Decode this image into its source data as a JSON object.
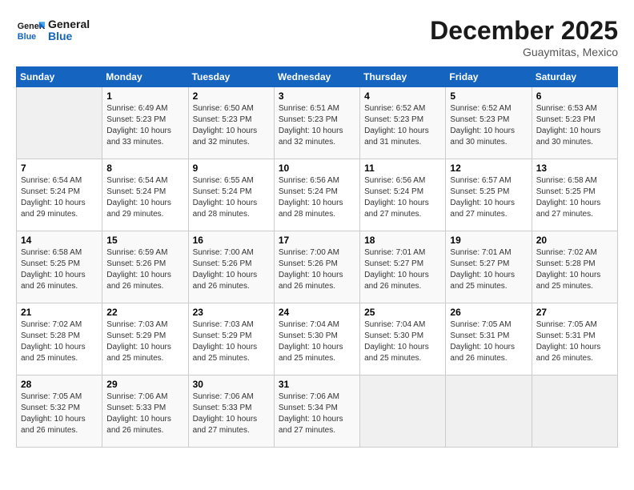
{
  "header": {
    "logo": {
      "line1": "General",
      "line2": "Blue"
    },
    "title": "December 2025",
    "location": "Guaymitas, Mexico"
  },
  "days_of_week": [
    "Sunday",
    "Monday",
    "Tuesday",
    "Wednesday",
    "Thursday",
    "Friday",
    "Saturday"
  ],
  "weeks": [
    [
      {
        "num": "",
        "empty": true
      },
      {
        "num": "1",
        "sunrise": "Sunrise: 6:49 AM",
        "sunset": "Sunset: 5:23 PM",
        "daylight": "Daylight: 10 hours and 33 minutes."
      },
      {
        "num": "2",
        "sunrise": "Sunrise: 6:50 AM",
        "sunset": "Sunset: 5:23 PM",
        "daylight": "Daylight: 10 hours and 32 minutes."
      },
      {
        "num": "3",
        "sunrise": "Sunrise: 6:51 AM",
        "sunset": "Sunset: 5:23 PM",
        "daylight": "Daylight: 10 hours and 32 minutes."
      },
      {
        "num": "4",
        "sunrise": "Sunrise: 6:52 AM",
        "sunset": "Sunset: 5:23 PM",
        "daylight": "Daylight: 10 hours and 31 minutes."
      },
      {
        "num": "5",
        "sunrise": "Sunrise: 6:52 AM",
        "sunset": "Sunset: 5:23 PM",
        "daylight": "Daylight: 10 hours and 30 minutes."
      },
      {
        "num": "6",
        "sunrise": "Sunrise: 6:53 AM",
        "sunset": "Sunset: 5:23 PM",
        "daylight": "Daylight: 10 hours and 30 minutes."
      }
    ],
    [
      {
        "num": "7",
        "sunrise": "Sunrise: 6:54 AM",
        "sunset": "Sunset: 5:24 PM",
        "daylight": "Daylight: 10 hours and 29 minutes."
      },
      {
        "num": "8",
        "sunrise": "Sunrise: 6:54 AM",
        "sunset": "Sunset: 5:24 PM",
        "daylight": "Daylight: 10 hours and 29 minutes."
      },
      {
        "num": "9",
        "sunrise": "Sunrise: 6:55 AM",
        "sunset": "Sunset: 5:24 PM",
        "daylight": "Daylight: 10 hours and 28 minutes."
      },
      {
        "num": "10",
        "sunrise": "Sunrise: 6:56 AM",
        "sunset": "Sunset: 5:24 PM",
        "daylight": "Daylight: 10 hours and 28 minutes."
      },
      {
        "num": "11",
        "sunrise": "Sunrise: 6:56 AM",
        "sunset": "Sunset: 5:24 PM",
        "daylight": "Daylight: 10 hours and 27 minutes."
      },
      {
        "num": "12",
        "sunrise": "Sunrise: 6:57 AM",
        "sunset": "Sunset: 5:25 PM",
        "daylight": "Daylight: 10 hours and 27 minutes."
      },
      {
        "num": "13",
        "sunrise": "Sunrise: 6:58 AM",
        "sunset": "Sunset: 5:25 PM",
        "daylight": "Daylight: 10 hours and 27 minutes."
      }
    ],
    [
      {
        "num": "14",
        "sunrise": "Sunrise: 6:58 AM",
        "sunset": "Sunset: 5:25 PM",
        "daylight": "Daylight: 10 hours and 26 minutes."
      },
      {
        "num": "15",
        "sunrise": "Sunrise: 6:59 AM",
        "sunset": "Sunset: 5:26 PM",
        "daylight": "Daylight: 10 hours and 26 minutes."
      },
      {
        "num": "16",
        "sunrise": "Sunrise: 7:00 AM",
        "sunset": "Sunset: 5:26 PM",
        "daylight": "Daylight: 10 hours and 26 minutes."
      },
      {
        "num": "17",
        "sunrise": "Sunrise: 7:00 AM",
        "sunset": "Sunset: 5:26 PM",
        "daylight": "Daylight: 10 hours and 26 minutes."
      },
      {
        "num": "18",
        "sunrise": "Sunrise: 7:01 AM",
        "sunset": "Sunset: 5:27 PM",
        "daylight": "Daylight: 10 hours and 26 minutes."
      },
      {
        "num": "19",
        "sunrise": "Sunrise: 7:01 AM",
        "sunset": "Sunset: 5:27 PM",
        "daylight": "Daylight: 10 hours and 25 minutes."
      },
      {
        "num": "20",
        "sunrise": "Sunrise: 7:02 AM",
        "sunset": "Sunset: 5:28 PM",
        "daylight": "Daylight: 10 hours and 25 minutes."
      }
    ],
    [
      {
        "num": "21",
        "sunrise": "Sunrise: 7:02 AM",
        "sunset": "Sunset: 5:28 PM",
        "daylight": "Daylight: 10 hours and 25 minutes."
      },
      {
        "num": "22",
        "sunrise": "Sunrise: 7:03 AM",
        "sunset": "Sunset: 5:29 PM",
        "daylight": "Daylight: 10 hours and 25 minutes."
      },
      {
        "num": "23",
        "sunrise": "Sunrise: 7:03 AM",
        "sunset": "Sunset: 5:29 PM",
        "daylight": "Daylight: 10 hours and 25 minutes."
      },
      {
        "num": "24",
        "sunrise": "Sunrise: 7:04 AM",
        "sunset": "Sunset: 5:30 PM",
        "daylight": "Daylight: 10 hours and 25 minutes."
      },
      {
        "num": "25",
        "sunrise": "Sunrise: 7:04 AM",
        "sunset": "Sunset: 5:30 PM",
        "daylight": "Daylight: 10 hours and 25 minutes."
      },
      {
        "num": "26",
        "sunrise": "Sunrise: 7:05 AM",
        "sunset": "Sunset: 5:31 PM",
        "daylight": "Daylight: 10 hours and 26 minutes."
      },
      {
        "num": "27",
        "sunrise": "Sunrise: 7:05 AM",
        "sunset": "Sunset: 5:31 PM",
        "daylight": "Daylight: 10 hours and 26 minutes."
      }
    ],
    [
      {
        "num": "28",
        "sunrise": "Sunrise: 7:05 AM",
        "sunset": "Sunset: 5:32 PM",
        "daylight": "Daylight: 10 hours and 26 minutes."
      },
      {
        "num": "29",
        "sunrise": "Sunrise: 7:06 AM",
        "sunset": "Sunset: 5:33 PM",
        "daylight": "Daylight: 10 hours and 26 minutes."
      },
      {
        "num": "30",
        "sunrise": "Sunrise: 7:06 AM",
        "sunset": "Sunset: 5:33 PM",
        "daylight": "Daylight: 10 hours and 27 minutes."
      },
      {
        "num": "31",
        "sunrise": "Sunrise: 7:06 AM",
        "sunset": "Sunset: 5:34 PM",
        "daylight": "Daylight: 10 hours and 27 minutes."
      },
      {
        "num": "",
        "empty": true
      },
      {
        "num": "",
        "empty": true
      },
      {
        "num": "",
        "empty": true
      }
    ]
  ]
}
